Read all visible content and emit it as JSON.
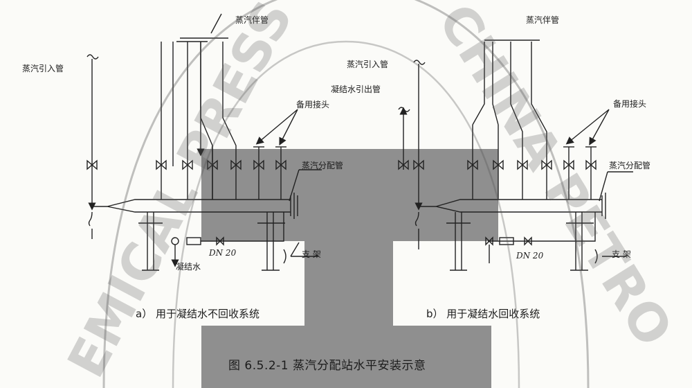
{
  "labels": {
    "steam_inlet_left": "蒸汽引入管",
    "steam_companion_left": "蒸汽伴管",
    "spare_joint_left": "备用接头",
    "steam_header_left": "蒸汽分配管",
    "condensate_left": "凝结水",
    "dn_left": "DN 20",
    "support_left": "支 架",
    "steam_companion_right": "蒸汽伴管",
    "steam_inlet_right": "蒸汽引入管",
    "condensate_outlet_right": "凝结水引出管",
    "spare_joint_right": "备用接头",
    "steam_header_right": "蒸汽分配管",
    "dn_right": "DN 20",
    "support_right": "支 架"
  },
  "subcaptions": {
    "a": "a）  用于凝结水不回收系统",
    "b": "b）  用于凝结水回收系统"
  },
  "caption": "图 6.5.2-1   蒸汽分配站水平安装示意",
  "watermark": {
    "left": "EMICAL PRESS",
    "right": "CHINA PETRO"
  },
  "colors": {
    "line": "#222222",
    "gray_block": "#8f8f8f",
    "background": "#fbfbf8"
  }
}
